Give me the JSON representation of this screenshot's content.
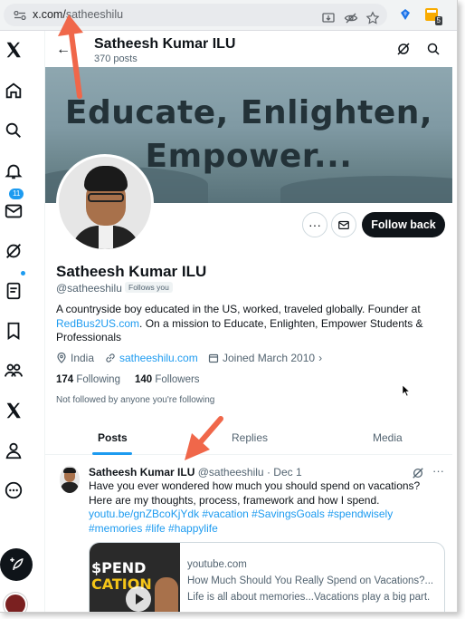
{
  "browser": {
    "url_host": "x.com/",
    "url_path": "satheeshilu",
    "extension_badge": "5"
  },
  "header": {
    "name": "Satheesh Kumar ILU",
    "posts_count": "370 posts"
  },
  "banner": {
    "line1": "Educate, Enlighten,",
    "line2": "Empower..."
  },
  "left_nav": {
    "notifications_badge": "11"
  },
  "profile": {
    "name": "Satheesh Kumar ILU",
    "handle": "@satheeshilu",
    "follows_you": "Follows you",
    "bio_part1": "A countryside boy educated in the US, worked, traveled globally. Founder at ",
    "bio_link": "RedBus2US.com",
    "bio_part2": ". On a mission to Educate, Enlighten, Empower Students & Professionals",
    "location": "India",
    "website": "satheeshilu.com",
    "joined": "Joined March 2010",
    "following_count": "174",
    "following_label": "Following",
    "followers_count": "140",
    "followers_label": "Followers",
    "not_followed": "Not followed by anyone you're following",
    "follow_back_label": "Follow back"
  },
  "tabs": [
    {
      "label": "Posts",
      "active": true
    },
    {
      "label": "Replies",
      "active": false
    },
    {
      "label": "Media",
      "active": false
    }
  ],
  "tweet": {
    "author": "Satheesh Kumar ILU",
    "handle": "@satheeshilu",
    "date": "· Dec 1",
    "text": "Have you ever wondered how much you should spend on vacations? Here are my thoughts, process, framework and how I spend.",
    "link": "youtu.be/gnZBcoKjYdk",
    "hashtags_line1": "#vacation #SavingsGoals #spendwisely",
    "hashtags_line2": "#memories #life #happylife",
    "card": {
      "thumb_line1": "$PEND",
      "thumb_line2": "CATION",
      "domain": "youtube.com",
      "title": "How Much Should You Really Spend on Vacations?...",
      "description": "Life is all about memories...Vacations play a big part."
    }
  },
  "colors": {
    "accent": "#1d9bf0",
    "annotation_arrow": "#f0674a",
    "text_primary": "#0f1419",
    "text_secondary": "#536471"
  }
}
